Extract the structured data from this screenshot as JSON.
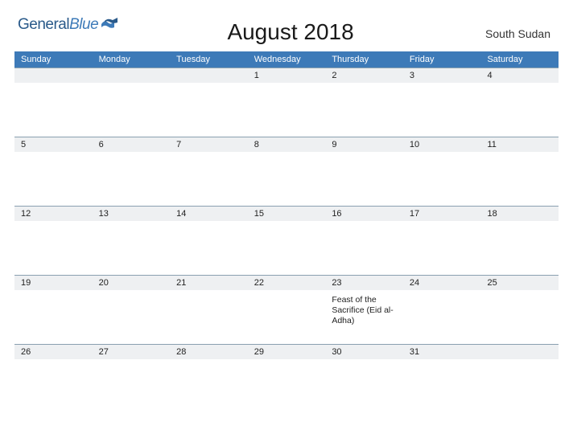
{
  "brand": {
    "word1": "General",
    "word2": "Blue"
  },
  "title": "August 2018",
  "region": "South Sudan",
  "dayHeaders": [
    "Sunday",
    "Monday",
    "Tuesday",
    "Wednesday",
    "Thursday",
    "Friday",
    "Saturday"
  ],
  "weeks": [
    [
      {
        "num": ""
      },
      {
        "num": ""
      },
      {
        "num": ""
      },
      {
        "num": "1"
      },
      {
        "num": "2"
      },
      {
        "num": "3"
      },
      {
        "num": "4"
      }
    ],
    [
      {
        "num": "5"
      },
      {
        "num": "6"
      },
      {
        "num": "7"
      },
      {
        "num": "8"
      },
      {
        "num": "9"
      },
      {
        "num": "10"
      },
      {
        "num": "11"
      }
    ],
    [
      {
        "num": "12"
      },
      {
        "num": "13"
      },
      {
        "num": "14"
      },
      {
        "num": "15"
      },
      {
        "num": "16"
      },
      {
        "num": "17"
      },
      {
        "num": "18"
      }
    ],
    [
      {
        "num": "19"
      },
      {
        "num": "20"
      },
      {
        "num": "21"
      },
      {
        "num": "22"
      },
      {
        "num": "23",
        "event": "Feast of the Sacrifice (Eid al-Adha)"
      },
      {
        "num": "24"
      },
      {
        "num": "25"
      }
    ],
    [
      {
        "num": "26"
      },
      {
        "num": "27"
      },
      {
        "num": "28"
      },
      {
        "num": "29"
      },
      {
        "num": "30"
      },
      {
        "num": "31"
      },
      {
        "num": ""
      }
    ]
  ]
}
